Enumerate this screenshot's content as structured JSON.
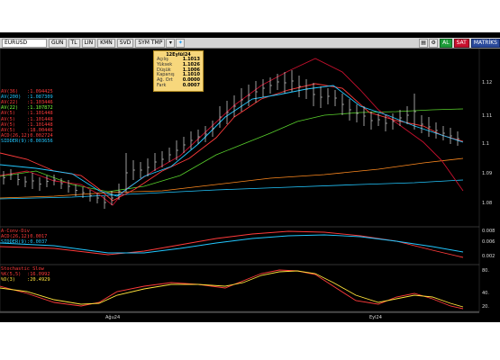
{
  "toolbar": {
    "symbol": "EURUSD",
    "period": "GUN",
    "currency": "TL",
    "lin": "LIN",
    "kmn": "KMN",
    "svd": "SVD",
    "sym_tmp": "SYM TMP",
    "al": "AL",
    "sat": "SAT",
    "brand": "MATRİKS"
  },
  "tooltip": {
    "title": "12Eylül24",
    "rows": [
      {
        "k": "Açılış",
        "v": "1.1013"
      },
      {
        "k": "Yüksek",
        "v": "1.1026"
      },
      {
        "k": "Düşük",
        "v": "1.1006"
      },
      {
        "k": "Kapanış",
        "v": "1.1010"
      },
      {
        "k": "Ağ. Ort",
        "v": "0.0000"
      },
      {
        "k": "Fark",
        "v": "0.0007"
      }
    ]
  },
  "legend": [
    {
      "label": "AV(36)",
      "value": "1.094425",
      "color": "#ff3b3b"
    },
    {
      "label": "AV(200)",
      "value": "1.087309",
      "color": "#22c7ff"
    },
    {
      "label": "AV(22)",
      "value": "1.103446",
      "color": "#ff3b3b"
    },
    {
      "label": "AV(22)",
      "value": "1.107872",
      "color": "#7cff3c"
    },
    {
      "label": "AV(5)",
      "value": "1.101448",
      "color": "#ff3b3b"
    },
    {
      "label": "AV(5)",
      "value": "1.101448",
      "color": "#ff3b3b"
    },
    {
      "label": "AV(5)",
      "value": "1.101448",
      "color": "#ff3b3b"
    },
    {
      "label": "AV(5)",
      "value": "18.00446",
      "color": "#ff3b3b"
    },
    {
      "label": "ACD(26,12)",
      "value": "0.002724",
      "color": "#ff3b3b"
    },
    {
      "label": "SIDDER(9)",
      "value": "0.003656",
      "color": "#22c7ff"
    }
  ],
  "macd_legend": [
    {
      "label": "A-Conv-Div",
      "value": "",
      "color": "#ff3b3b"
    },
    {
      "label": "ACD(26,12)",
      "value": "0.0017",
      "color": "#ff3b3b"
    },
    {
      "label": "SIDDER(9)",
      "value": "0.0037",
      "color": "#22c7ff"
    }
  ],
  "stoch_legend": [
    {
      "label": "Stochastic Slow",
      "value": "",
      "color": "#ff3b3b"
    },
    {
      "label": "%K(5,5)",
      "value": "16.0992",
      "color": "#ff3b3b"
    },
    {
      "label": "%D(3)",
      "value": "20.4929",
      "color": "#ffe23a"
    }
  ],
  "price_axis": [
    "1.12",
    "1.11",
    "1.1",
    "1.09",
    "1.08"
  ],
  "macd_axis": [
    "0.008",
    "0.006",
    "0.002"
  ],
  "stoch_axis": [
    "80.",
    "40.",
    "20."
  ],
  "time_axis": [
    "Ağu24",
    "Eyl24"
  ],
  "colors": {
    "background": "#000000",
    "ma_red": "#ff3b3b",
    "ma_cyan": "#22c7ff",
    "ma_green": "#59d12c",
    "ma_orange": "#ff8a1f",
    "ma_dark_red": "#c8102e",
    "candle": "#dddddd",
    "stoch_d": "#ffe23a"
  }
}
